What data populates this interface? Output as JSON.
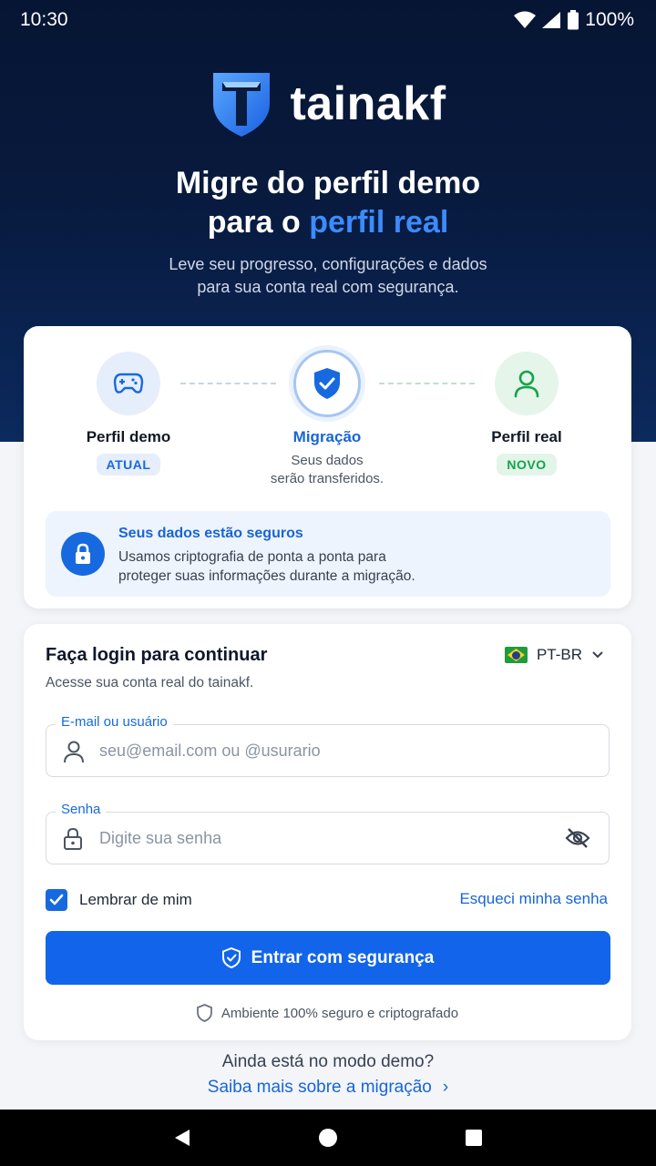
{
  "status_bar": {
    "time": "10:30",
    "battery": "100%"
  },
  "brand": {
    "name": "tainakf"
  },
  "hero": {
    "headline_line1": "Migre do perfil demo",
    "headline_line2_prefix": "para o ",
    "headline_line2_accent": "perfil real",
    "subtitle_line1": "Leve seu progresso, configurações e dados",
    "subtitle_line2": "para sua conta real com segurança."
  },
  "steps": [
    {
      "label": "Perfil demo",
      "badge": "ATUAL",
      "icon": "gamepad-icon"
    },
    {
      "label": "Migração",
      "desc_line1": "Seus dados",
      "desc_line2": "serão transferidos.",
      "icon": "shield-check-icon"
    },
    {
      "label": "Perfil real",
      "badge": "NOVO",
      "icon": "user-icon"
    }
  ],
  "security_notice": {
    "title": "Seus dados estão seguros",
    "text_line1": "Usamos criptografia de ponta a ponta para",
    "text_line2": "proteger suas informações durante a migração."
  },
  "login": {
    "title": "Faça login para continuar",
    "subtitle": "Acesse sua conta real do tainakf.",
    "language": "PT-BR",
    "email_label": "E-mail ou usuário",
    "email_placeholder": "seu@email.com ou @usurario",
    "password_label": "Senha",
    "password_placeholder": "Digite sua senha",
    "remember_label": "Lembrar de mim",
    "remember_checked": true,
    "forgot_link": "Esqueci minha senha",
    "submit_label": "Entrar com segurança",
    "safe_note": "Ambiente 100% seguro e criptografado"
  },
  "footer": {
    "question": "Ainda está no modo demo?",
    "link": "Saiba mais sobre a migração"
  },
  "colors": {
    "primary": "#1265ea",
    "hero_bg": "#061533",
    "accent_text": "#3b8cff",
    "success": "#16a34a"
  }
}
